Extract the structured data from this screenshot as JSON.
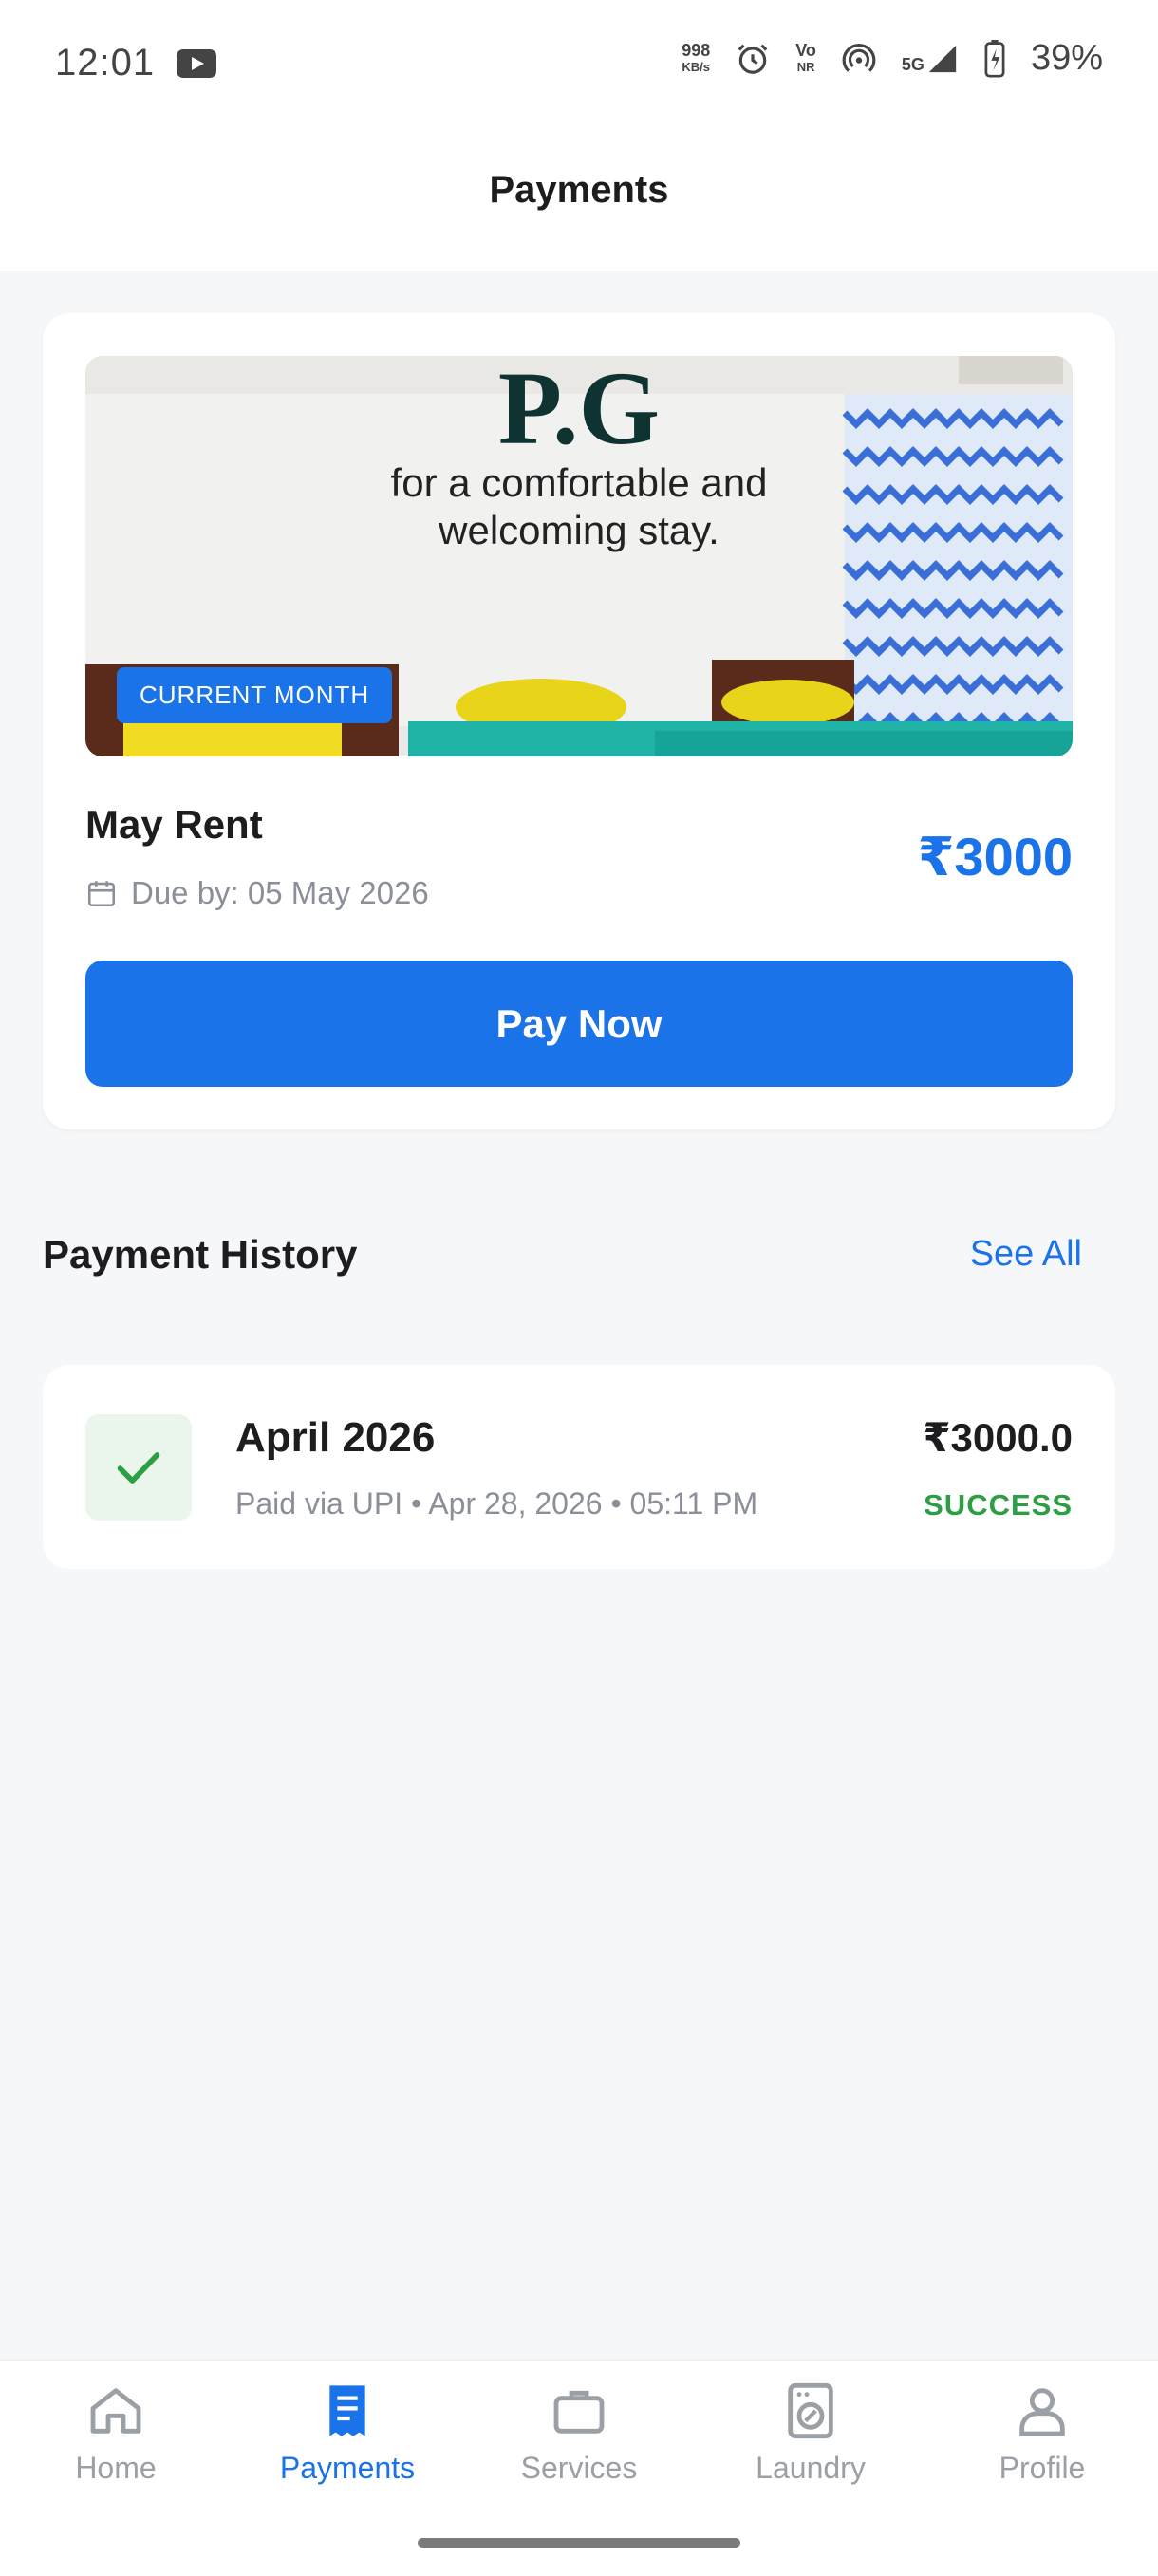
{
  "status_bar": {
    "time": "12:01",
    "net_speed_value": "998",
    "net_speed_unit": "KB/s",
    "volte": "Vo",
    "volte_sub": "NR",
    "network": "5G",
    "battery": "39%"
  },
  "header": {
    "title": "Payments"
  },
  "rent_card": {
    "banner": {
      "heading": "P.G",
      "line1": "for a comfortable and",
      "line2": "welcoming stay.",
      "badge": "CURRENT MONTH"
    },
    "title": "May Rent",
    "due": "Due by: 05 May 2026",
    "amount": "₹3000",
    "pay_button": "Pay Now"
  },
  "history": {
    "title": "Payment History",
    "see_all": "See All",
    "items": [
      {
        "title": "April 2026",
        "subtitle": "Paid via UPI • Apr 28, 2026 • 05:11 PM",
        "amount": "₹3000.0",
        "status": "SUCCESS"
      }
    ]
  },
  "nav": {
    "items": [
      {
        "label": "Home",
        "icon": "home-icon"
      },
      {
        "label": "Payments",
        "icon": "receipt-icon",
        "active": true
      },
      {
        "label": "Services",
        "icon": "briefcase-icon"
      },
      {
        "label": "Laundry",
        "icon": "washing-machine-icon"
      },
      {
        "label": "Profile",
        "icon": "person-icon"
      }
    ]
  },
  "colors": {
    "accent": "#1a73e8",
    "success": "#2e9e44",
    "background": "#f6f7f9"
  }
}
